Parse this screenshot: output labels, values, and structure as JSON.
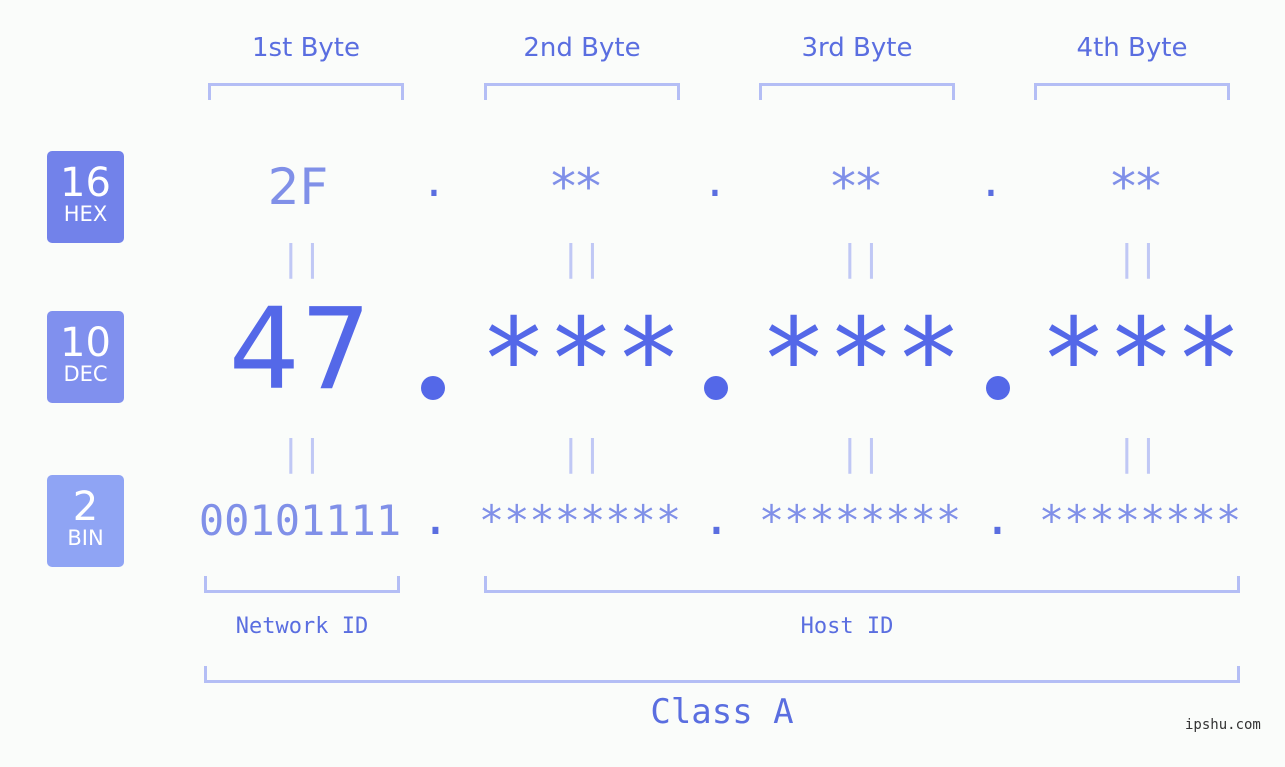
{
  "headers": [
    "1st Byte",
    "2nd Byte",
    "3rd Byte",
    "4th Byte"
  ],
  "badges": {
    "hex": {
      "num": "16",
      "label": "HEX",
      "color": "#7282ea"
    },
    "dec": {
      "num": "10",
      "label": "DEC",
      "color": "#8090ee"
    },
    "bin": {
      "num": "2",
      "label": "BIN",
      "color": "#8fa4f4"
    }
  },
  "hex_values": [
    "2F",
    "**",
    "**",
    "**"
  ],
  "dec_values": [
    "47",
    "***",
    "***",
    "***"
  ],
  "bin_values": [
    "00101111",
    "********",
    "********",
    "********"
  ],
  "separator": ".",
  "equals": "||",
  "network_label": "Network ID",
  "host_label": "Host ID",
  "class_label": "Class A",
  "watermark": "ipshu.com"
}
